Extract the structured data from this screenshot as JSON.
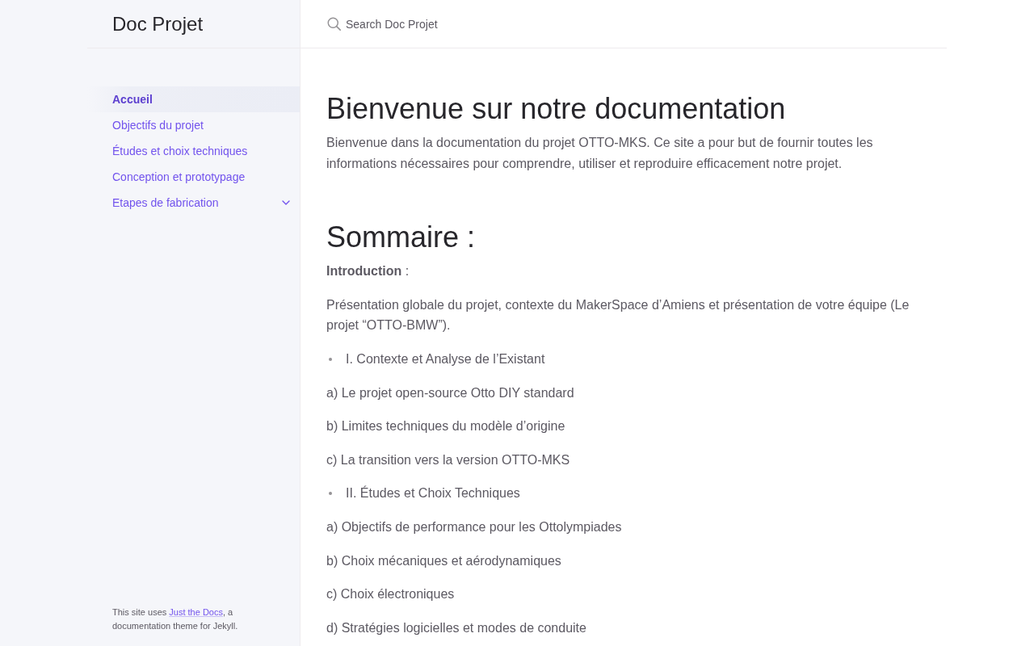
{
  "sidebar": {
    "title": "Doc Projet",
    "nav": [
      {
        "label": "Accueil",
        "kind": "link",
        "selected": true
      },
      {
        "label": "Objectifs du projet",
        "kind": "link",
        "selected": false
      },
      {
        "label": "Études et choix techniques",
        "kind": "link",
        "selected": false
      },
      {
        "label": "Conception et prototypage",
        "kind": "link",
        "selected": false
      },
      {
        "label": "Etapes de fabrication",
        "kind": "group",
        "selected": false,
        "expanded": false
      }
    ],
    "footer": {
      "before": "This site uses ",
      "link": "Just the Docs",
      "after": ", a documentation theme for Jekyll."
    }
  },
  "search": {
    "placeholder": "Search Doc Projet"
  },
  "content": [
    {
      "kind": "heading",
      "text": "Bienvenue sur notre documentation"
    },
    {
      "kind": "paragraph",
      "text": "Bienvenue dans la documentation du projet OTTO-MKS. Ce site a pour but de fournir toutes les informations nécessaires pour comprendre, utiliser et reproduire efficacement notre projet."
    },
    {
      "kind": "heading",
      "text": "Sommaire :"
    },
    {
      "kind": "paragraph",
      "text": "**Introduction** :"
    },
    {
      "kind": "paragraph",
      "text": "Présentation globale du projet, contexte du MakerSpace d’Amiens et présentation de votre équipe (Le projet “OTTO-BMW”)."
    },
    {
      "kind": "bullet",
      "text": "I. Contexte et Analyse de l’Existant"
    },
    {
      "kind": "paragraph",
      "text": "a) Le projet open-source Otto DIY standard"
    },
    {
      "kind": "paragraph",
      "text": "b) Limites techniques du modèle d’origine"
    },
    {
      "kind": "paragraph",
      "text": "c) La transition vers la version OTTO-MKS"
    },
    {
      "kind": "bullet",
      "text": "II. Études et Choix Techniques"
    },
    {
      "kind": "paragraph",
      "text": "a) Objectifs de performance pour les Ottolympiades"
    },
    {
      "kind": "paragraph",
      "text": "b) Choix mécaniques et aérodynamiques"
    },
    {
      "kind": "paragraph",
      "text": "c) Choix électroniques"
    },
    {
      "kind": "paragraph",
      "text": "d) Stratégies logicielles et modes de conduite"
    }
  ]
}
